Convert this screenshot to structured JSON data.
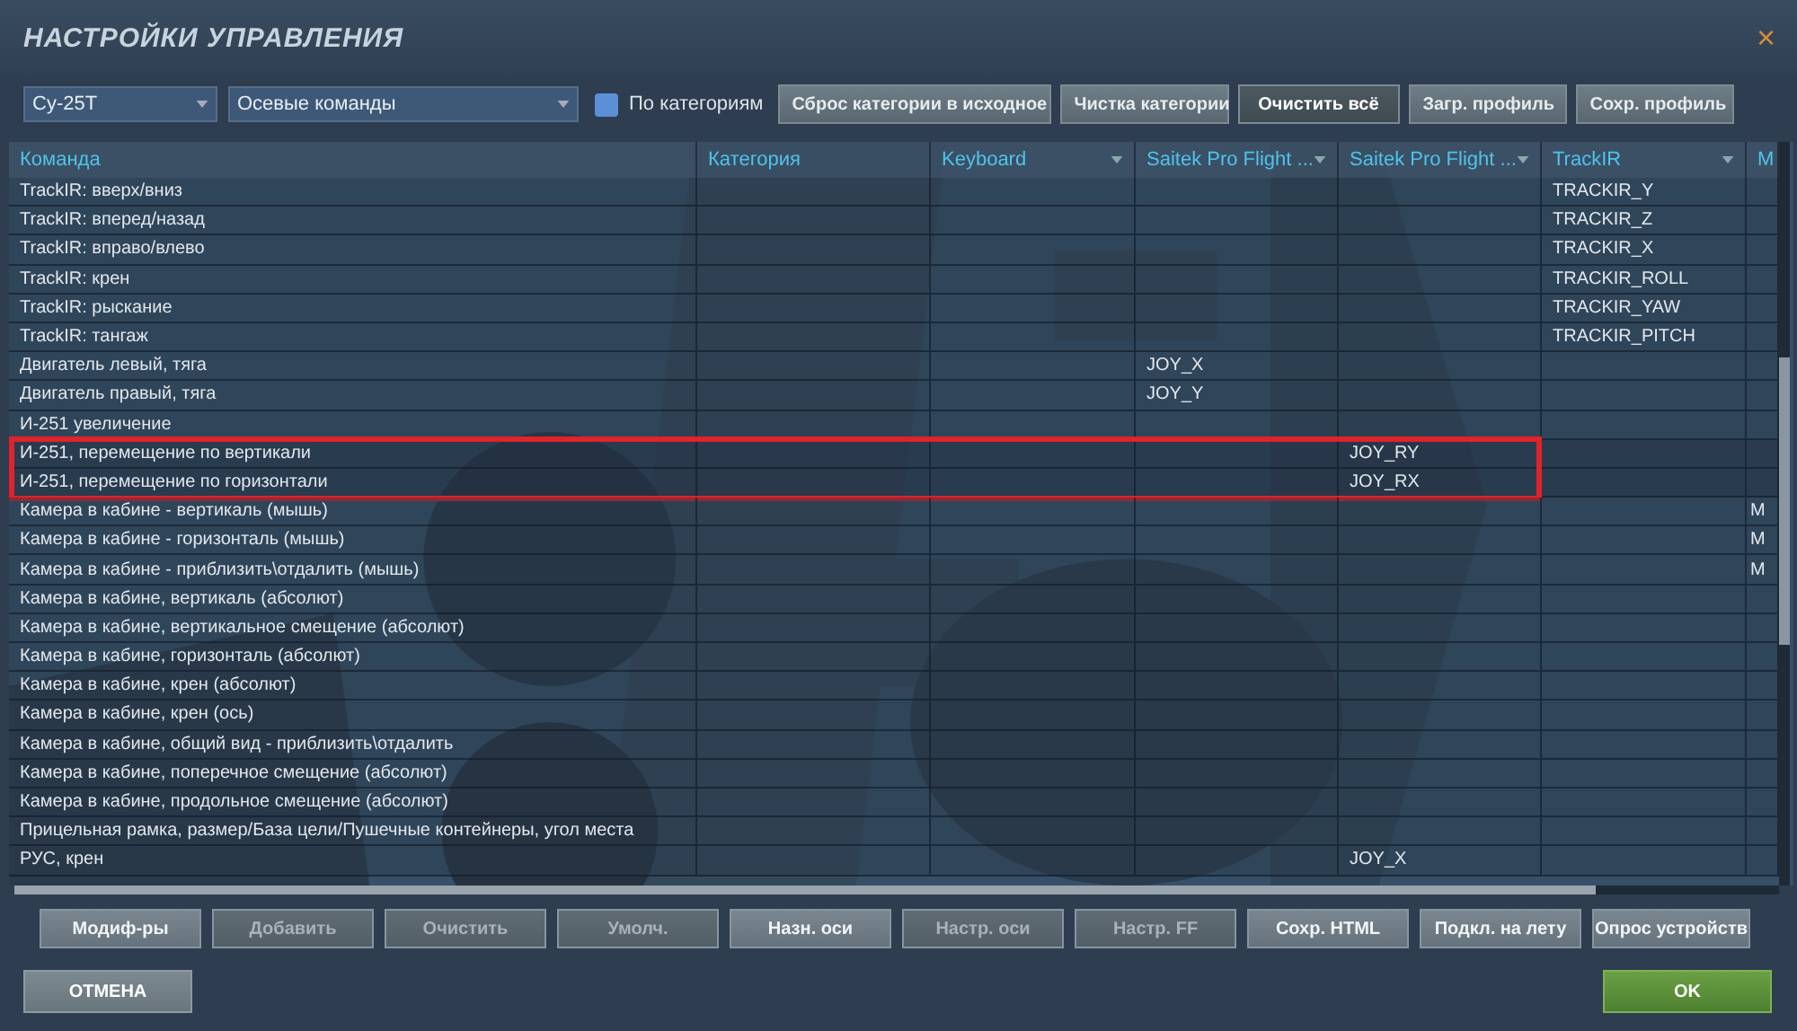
{
  "window": {
    "title": "НАСТРОЙКИ УПРАВЛЕНИЯ",
    "close": "×"
  },
  "toolbar": {
    "aircraft": "Су-25Т",
    "category": "Осевые команды",
    "by_categories": {
      "label": "По категориям",
      "checked": false
    },
    "buttons": [
      {
        "label": "Сброс категории в исходное",
        "highlighted": false
      },
      {
        "label": "Чистка категории",
        "highlighted": false
      },
      {
        "label": "Очистить всё",
        "highlighted": true
      },
      {
        "label": "Загр. профиль",
        "highlighted": false
      },
      {
        "label": "Сохр. профиль",
        "highlighted": false
      }
    ]
  },
  "table": {
    "columns": [
      {
        "label": "Команда",
        "dropdown": false
      },
      {
        "label": "Категория",
        "dropdown": false
      },
      {
        "label": "Keyboard",
        "dropdown": true
      },
      {
        "label": "Saitek Pro Flight ...",
        "dropdown": true
      },
      {
        "label": "Saitek Pro Flight ...",
        "dropdown": true
      },
      {
        "label": "TrackIR",
        "dropdown": true
      },
      {
        "label": "M",
        "dropdown": false
      }
    ],
    "rows": [
      {
        "command": "TrackIR: вверх/вниз",
        "trackir": "TRACKIR_Y",
        "highlighted": false
      },
      {
        "command": "TrackIR: вперед/назад",
        "trackir": "TRACKIR_Z",
        "highlighted": false
      },
      {
        "command": "TrackIR: вправо/влево",
        "trackir": "TRACKIR_X",
        "highlighted": false
      },
      {
        "command": "TrackIR: крен",
        "trackir": "TRACKIR_ROLL",
        "highlighted": false
      },
      {
        "command": "TrackIR: рыскание",
        "trackir": "TRACKIR_YAW",
        "highlighted": false
      },
      {
        "command": "TrackIR: тангаж",
        "trackir": "TRACKIR_PITCH",
        "highlighted": false
      },
      {
        "command": "Двигатель левый, тяга",
        "saitek_1": "JOY_X",
        "highlighted": false
      },
      {
        "command": "Двигатель правый, тяга",
        "saitek_1": "JOY_Y",
        "highlighted": false
      },
      {
        "command": "И-251 увеличение",
        "highlighted": false
      },
      {
        "command": "И-251, перемещение по вертикали",
        "saitek_2": "JOY_RY",
        "highlighted": true
      },
      {
        "command": "И-251, перемещение по горизонтали",
        "saitek_2": "JOY_RX",
        "highlighted": true
      },
      {
        "command": "Камера в кабине - вертикаль (мышь)",
        "column_7": "M",
        "highlighted": false
      },
      {
        "command": "Камера в кабине - горизонталь (мышь)",
        "column_7": "M",
        "highlighted": false
      },
      {
        "command": "Камера в кабине - приблизить\\отдалить (мышь)",
        "column_7": "M",
        "highlighted": false
      },
      {
        "command": "Камера в кабине, вертикаль (абсолют)",
        "highlighted": false
      },
      {
        "command": "Камера в кабине, вертикальное смещение (абсолют)",
        "highlighted": false
      },
      {
        "command": "Камера в кабине, горизонталь (абсолют)",
        "highlighted": false
      },
      {
        "command": "Камера в кабине, крен (абсолют)",
        "highlighted": false
      },
      {
        "command": "Камера в кабине, крен (ось)",
        "highlighted": false
      },
      {
        "command": "Камера в кабине, общий вид - приблизить\\отдалить",
        "highlighted": false
      },
      {
        "command": "Камера в кабине, поперечное смещение (абсолют)",
        "highlighted": false
      },
      {
        "command": "Камера в кабине, продольное смещение (абсолют)",
        "highlighted": false
      },
      {
        "command": "Прицельная рамка, размер/База цели/Пушечные контейнеры, угол места",
        "highlighted": false
      },
      {
        "command": "РУС, крен",
        "saitek_2": "JOY_X",
        "highlighted": false
      }
    ]
  },
  "actions": [
    {
      "label": "Модиф-ры",
      "disabled": false
    },
    {
      "label": "Добавить",
      "disabled": true
    },
    {
      "label": "Очистить",
      "disabled": true
    },
    {
      "label": "Умолч.",
      "disabled": true
    },
    {
      "label": "Назн. оси",
      "disabled": false
    },
    {
      "label": "Настр. оси",
      "disabled": true
    },
    {
      "label": "Настр. FF",
      "disabled": true
    },
    {
      "label": "Сохр. HTML",
      "disabled": false
    },
    {
      "label": "Подкл. на лету",
      "disabled": false
    },
    {
      "label": "Опрос устройств",
      "disabled": false
    }
  ],
  "footer": {
    "cancel": "ОТМЕНА",
    "ok": "OK"
  }
}
